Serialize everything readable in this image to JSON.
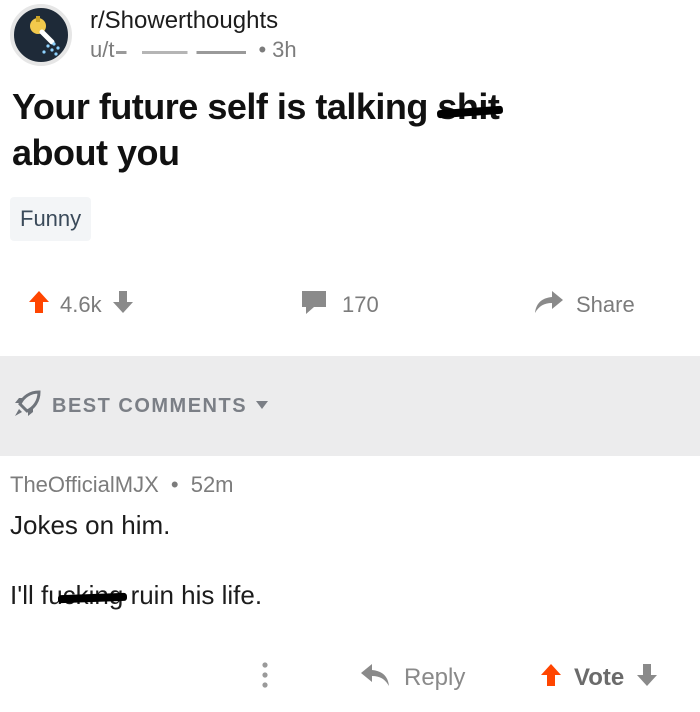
{
  "post": {
    "subreddit": "r/Showerthoughts",
    "user_prefix": "u/t",
    "separator": "•",
    "age": "3h",
    "title_main": "Your future self is talking ",
    "title_censored": "shit",
    "title_end": "about you",
    "flair": "Funny"
  },
  "actions": {
    "score": "4.6k",
    "comments": "170",
    "share": "Share"
  },
  "sort": {
    "label": "BEST COMMENTS"
  },
  "comment": {
    "author": "TheOfficialMJX",
    "separator": "•",
    "age": "52m",
    "line1": "Jokes on him.",
    "line2_start": "I'll f",
    "line2_censored": "ucking",
    "line2_end": " ruin his life.",
    "reply": "Reply",
    "vote": "Vote"
  },
  "colors": {
    "upvote_orange": "#ff4500",
    "muted_gray": "#7c7c7c",
    "sort_bar_bg": "#ececed"
  },
  "icons": [
    "subreddit-avatar-icon",
    "upvote-icon",
    "downvote-icon",
    "comment-icon",
    "share-icon",
    "rocket-icon",
    "caret-down-icon",
    "more-icon",
    "reply-icon"
  ]
}
